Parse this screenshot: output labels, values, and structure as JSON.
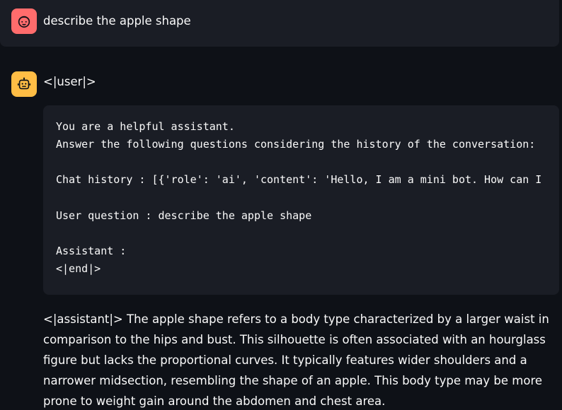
{
  "user_message": {
    "avatar_icon": "face-icon",
    "avatar_color": "#ff6c6c",
    "text": "describe the apple shape"
  },
  "assistant_message": {
    "avatar_icon": "robot-icon",
    "avatar_color": "#ffbd45",
    "header": "<|user|>",
    "code_lines": [
      "You are a helpful assistant.",
      "Answer the following questions considering the history of the conversation:",
      "Chat history : [{'role': 'ai', 'content': 'Hello, I am a mini bot. How can I",
      "User question : describe the apple shape",
      "Assistant :",
      "<|end|>"
    ],
    "answer": "<|assistant|> The apple shape refers to a body type characterized by a larger waist in comparison to the hips and bust. This silhouette is often associated with an hourglass figure but lacks the proportional curves. It typically features wider shoulders and a narrower midsection, resembling the shape of an apple. This body type may be more prone to weight gain around the abdomen and chest area."
  }
}
